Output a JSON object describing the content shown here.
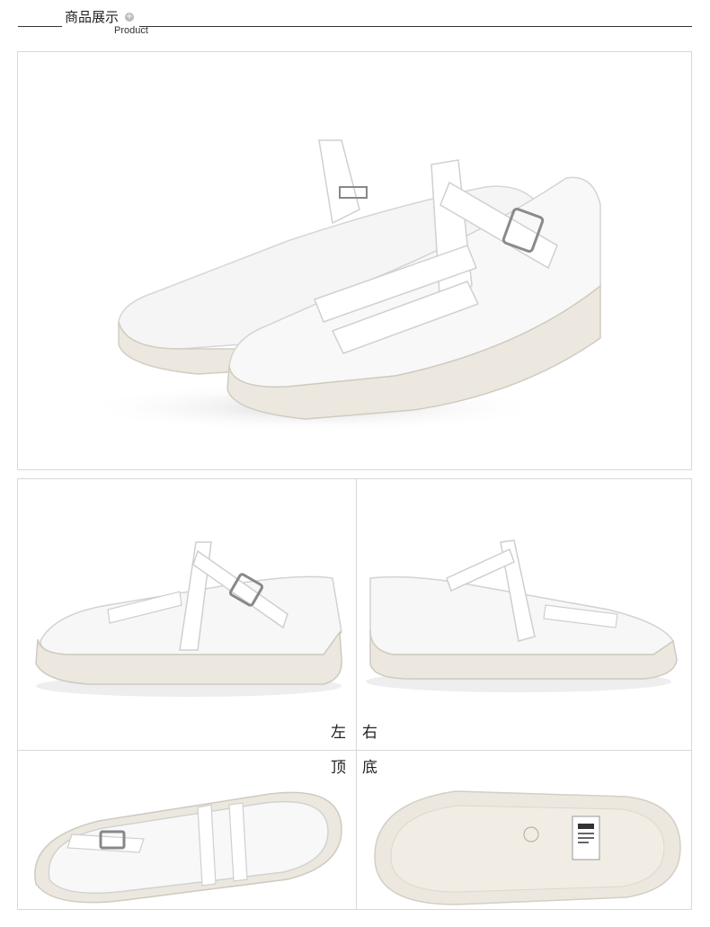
{
  "header": {
    "title": "商品展示",
    "subtitle": "Product",
    "expand_icon": "plus-circle-icon"
  },
  "views": {
    "left": "左",
    "right": "右",
    "top": "顶",
    "bottom": "底"
  },
  "colors": {
    "leather": "#f7f7f7",
    "sole": "#ece8df",
    "border": "#d8d8d8",
    "shadow": "#b9b9b9"
  }
}
